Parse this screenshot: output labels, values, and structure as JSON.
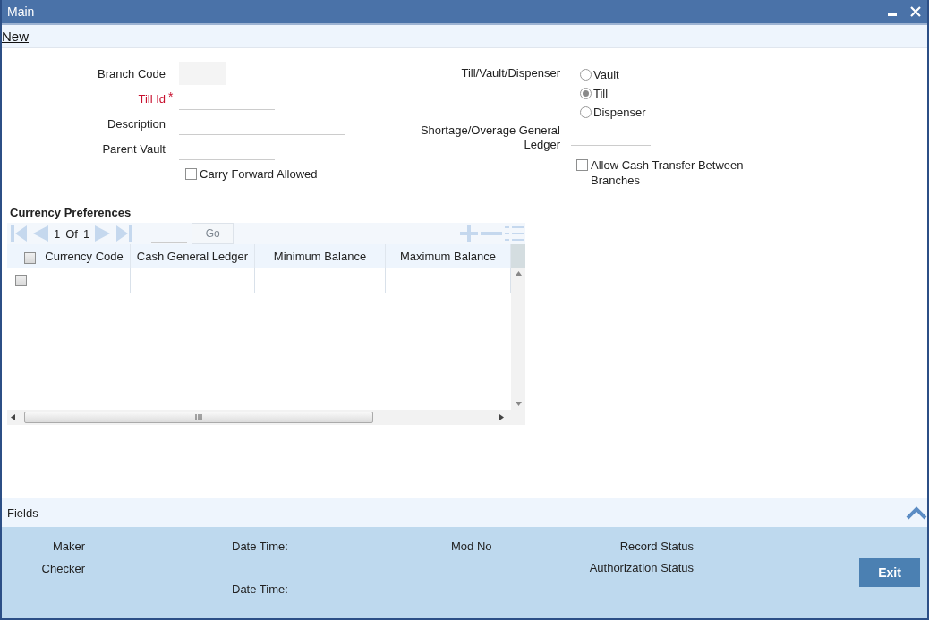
{
  "window": {
    "title": "Main"
  },
  "toolbar": {
    "link": "New"
  },
  "form_left": {
    "fields": [
      {
        "label": "Branch Code",
        "required": false,
        "kind": "readonly"
      },
      {
        "label": "Till Id",
        "required": true,
        "required_mark": "*",
        "kind": "text"
      },
      {
        "label": "Description",
        "required": false,
        "kind": "text"
      },
      {
        "label": "Parent Vault",
        "required": false,
        "kind": "text"
      }
    ],
    "checkbox": {
      "label": "Carry Forward Allowed",
      "checked": false
    }
  },
  "form_right": {
    "radio_group": {
      "label": "Till/Vault/Dispenser",
      "options": [
        {
          "label": "Vault",
          "selected": false
        },
        {
          "label": "Till",
          "selected": true
        },
        {
          "label": "Dispenser",
          "selected": false
        }
      ]
    },
    "ledger_field": {
      "label": "Shortage/Overage General Ledger"
    },
    "checkbox": {
      "label": "Allow Cash Transfer Between Branches",
      "checked": false
    }
  },
  "currency_preferences": {
    "title": "Currency Preferences",
    "pager": {
      "current": "1",
      "of": "Of",
      "total": "1",
      "go": "Go",
      "go_disabled": true
    },
    "columns": [
      "Currency Code",
      "Cash General Ledger",
      "Minimum Balance",
      "Maximum Balance"
    ],
    "header_checked": false,
    "rows": [
      {
        "checked": false
      }
    ]
  },
  "fields_bar": {
    "title": "Fields"
  },
  "audit": {
    "maker": "Maker",
    "checker": "Checker",
    "date_time_1": "Date Time:",
    "date_time_2": "Date Time:",
    "mod_no": "Mod No",
    "record_status": "Record Status",
    "authorization_status": "Authorization Status"
  },
  "buttons": {
    "exit": "Exit"
  }
}
